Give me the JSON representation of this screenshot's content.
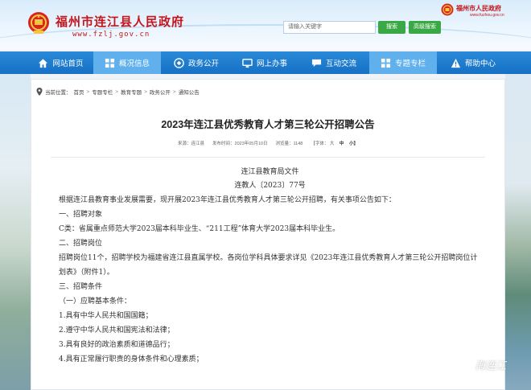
{
  "header": {
    "site_name": "福州市连江县人民政府",
    "site_url": "www.fzlj.gov.cn",
    "search_placeholder": "请输入关键字",
    "search_button": "搜索",
    "advanced_button": "高级搜索",
    "city_name": "福州市人民政府",
    "city_url": "www.fuzhou.gov.cn"
  },
  "nav": [
    {
      "label": "网站首页",
      "icon": "home-icon",
      "active": false
    },
    {
      "label": "概况信息",
      "icon": "overview-icon",
      "active": true
    },
    {
      "label": "政务公开",
      "icon": "gov-affairs-icon",
      "active": false
    },
    {
      "label": "网上办事",
      "icon": "online-service-icon",
      "active": false
    },
    {
      "label": "互动交流",
      "icon": "interaction-icon",
      "active": false
    },
    {
      "label": "专题专栏",
      "icon": "topics-icon",
      "active": true
    },
    {
      "label": "帮助中心",
      "icon": "help-icon",
      "active": false
    }
  ],
  "breadcrumb": {
    "prefix": "当前位置：",
    "items": [
      "首页",
      "专题专栏",
      "教育专题",
      "政务公开",
      "通知公告"
    ],
    "separator": ">"
  },
  "article": {
    "title": "2023年连江县优秀教育人才第三轮公开招聘公告",
    "source": "来源：连江县",
    "published": "发布时间：2023年05月10日",
    "views": "浏览量：1148",
    "font_size_label": "【字体：",
    "font_large": "大",
    "font_medium": "中",
    "font_small": "小】"
  },
  "doc": {
    "issuer": "连江县教育局文件",
    "doc_number": "连教人〔2023〕77号",
    "p1": "根据连江县教育事业发展需要，现开展2023年连江县优秀教育人才第三轮公开招聘，有关事项公告如下：",
    "h1": "一、招聘对象",
    "p2": "C类：省属重点师范大学2023届本科毕业生、“211工程”体育大学2023届本科毕业生。",
    "h2": "二、招聘岗位",
    "p3": "招聘岗位11个，招聘学校为福建省连江县直属学校。各岗位学科具体要求详见《2023年连江县优秀教育人才第三轮公开招聘岗位计划表》（附件1）。",
    "h3": "三、招聘条件",
    "h3_1": "（一）应聘基本条件：",
    "c1": "1.具有中华人民共和国国籍；",
    "c2": "2.遵守中华人民共和国宪法和法律；",
    "c3": "3.具有良好的政治素质和道德品行；",
    "c4": "4.具有正常履行职责的身体条件和心理素质；"
  },
  "watermark": "海连江",
  "colors": {
    "nav_bg": "#1670c4",
    "nav_active": "#5fb0ec",
    "brand_red": "#c4161c",
    "button_green": "#3aa845"
  }
}
